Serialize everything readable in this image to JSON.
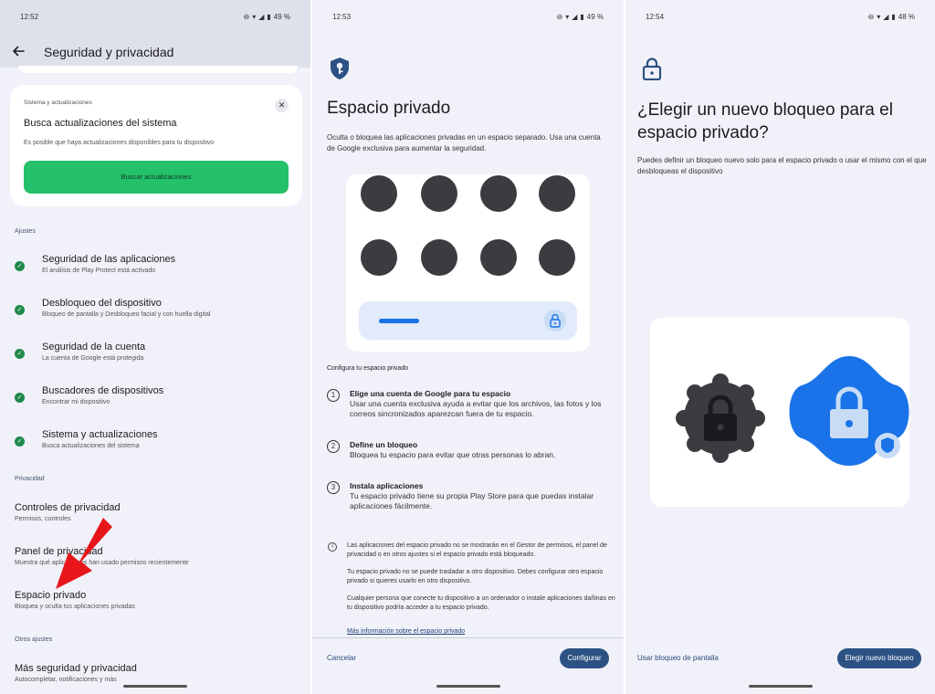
{
  "panel1": {
    "status": {
      "time": "12:52",
      "battery": "49 %"
    },
    "header": {
      "title": "Seguridad y privacidad"
    },
    "update_card": {
      "small_label": "Sistema y actualizaciones",
      "title": "Busca actualizaciones del sistema",
      "description": "Es posible que haya actualizaciones disponibles para tu dispositivo",
      "button": "Buscar actualizaciones"
    },
    "ajustes_label": "Ajustes",
    "ajustes": [
      {
        "title": "Seguridad de las aplicaciones",
        "subtitle": "El análisis de Play Protect está activado"
      },
      {
        "title": "Desbloqueo del dispositivo",
        "subtitle": "Bloqueo de pantalla y Desbloqueo facial y con huella digital"
      },
      {
        "title": "Seguridad de la cuenta",
        "subtitle": "La cuenta de Google está protegida"
      },
      {
        "title": "Buscadores de dispositivos",
        "subtitle": "Encontrar mi dispositivo"
      },
      {
        "title": "Sistema y actualizaciones",
        "subtitle": "Busca actualizaciones del sistema"
      }
    ],
    "privacidad_label": "Privacidad",
    "privacidad": [
      {
        "title": "Controles de privacidad",
        "subtitle": "Permisos, controles"
      },
      {
        "title": "Panel de privacidad",
        "subtitle": "Muestra qué aplicaciones han usado permisos recientemente"
      },
      {
        "title": "Espacio privado",
        "subtitle": "Bloquea y oculta tus aplicaciones privadas"
      }
    ],
    "otros_label": "Otros ajustes",
    "otros": [
      {
        "title": "Más seguridad y privacidad",
        "subtitle": "Autocompletar, notificaciones y más"
      }
    ]
  },
  "panel2": {
    "status": {
      "time": "12:53",
      "battery": "49 %"
    },
    "title": "Espacio privado",
    "description": "Oculta o bloquea las aplicaciones privadas en un espacio separado. Usa una cuenta de Google exclusiva para aumentar la seguridad.",
    "config_heading": "Configura tu espacio privado",
    "steps": [
      {
        "num": "1",
        "title": "Elige una cuenta de Google para tu espacio",
        "desc": "Usar una cuenta exclusiva ayuda a evitar que los archivos, las fotos y los correos sincronizados aparezcan fuera de tu espacio."
      },
      {
        "num": "2",
        "title": "Define un bloqueo",
        "desc": "Bloquea tu espacio para evitar que otras personas lo abran."
      },
      {
        "num": "3",
        "title": "Instala aplicaciones",
        "desc": "Tu espacio privado tiene su propia Play Store para que puedas instalar aplicaciones fácilmente."
      }
    ],
    "notes": [
      "Las aplicaciones del espacio privado no se mostrarán en el Gestor de permisos, el panel de privacidad o en otros ajustes si el espacio privado está bloqueado.",
      "Tu espacio privado no se puede trasladar a otro dispositivo. Debes configurar otro espacio privado si quieres usarlo en otro dispositivo.",
      "Cualquier persona que conecte tu dispositivo a un ordenador o instale aplicaciones dañinas en tu dispositivo podría acceder a tu espacio privado."
    ],
    "more_link": "Más información sobre el espacio privado",
    "cancel": "Cancelar",
    "configure": "Configurar"
  },
  "panel3": {
    "status": {
      "time": "12:54",
      "battery": "48 %"
    },
    "title": "¿Elegir un nuevo bloqueo para el espacio privado?",
    "description": "Puedes definir un bloqueo nuevo solo para el espacio privado o usar el mismo con el que desbloqueas el dispositivo",
    "use_screen_lock": "Usar bloqueo de pantalla",
    "choose_new": "Elegir nuevo bloqueo"
  },
  "colors": {
    "accent_green": "#25c06a",
    "primary_blue": "#2c5283",
    "illus_blue": "#1a73e8",
    "arrow_red": "#e8161b"
  }
}
